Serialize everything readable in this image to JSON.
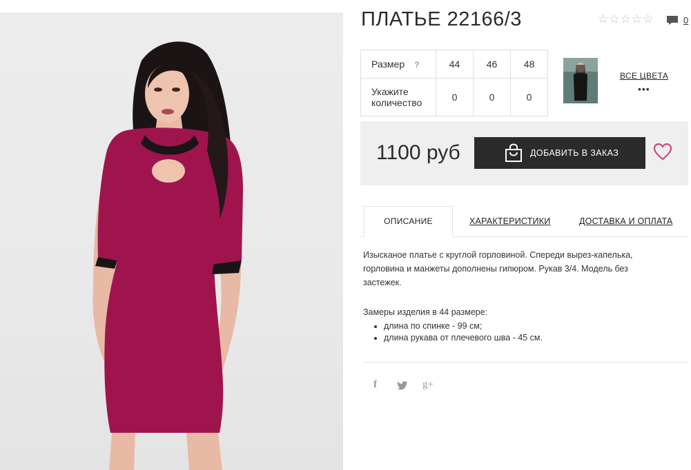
{
  "product": {
    "title": "ПЛАТЬЕ 22166/3",
    "rating_stars": 5,
    "rating_filled": 0,
    "comments_count": "0",
    "image": {
      "description_icon": "product-photo",
      "dress_color": "#a0144e"
    }
  },
  "sizes": {
    "size_label": "Размер",
    "help_mark": "?",
    "values": [
      "44",
      "46",
      "48"
    ],
    "quantity_label": "Укажите количество",
    "quantities": [
      "0",
      "0",
      "0"
    ]
  },
  "colors": {
    "all_colors_label": "ВСЕ ЦВЕТА",
    "more_dots": "•••"
  },
  "order": {
    "price": "1100 руб",
    "button_label": "ДОБАВИТЬ В ЗАКАЗ",
    "button_icon": "shopping-bag-icon",
    "wishlist_icon": "heart-icon",
    "accent_color": "#c94a77"
  },
  "tabs": [
    {
      "label": "ОПИСАНИЕ",
      "active": true
    },
    {
      "label": "ХАРАКТЕРИСТИКИ",
      "active": false
    },
    {
      "label": "ДОСТАВКА И ОПЛАТА",
      "active": false
    }
  ],
  "description": {
    "text": "Изысканое платье с круглой горловиной. Спереди вырез-капелька, горловина и манжеты дополнены гипюром. Рукав 3/4. Модель без застежек.",
    "measurements_title": "Замеры изделия в 44 размере:",
    "measurements": [
      "длина по спинке - 99 см;",
      "длина рукава от плечевого шва - 45 см."
    ]
  },
  "social": {
    "facebook": "f",
    "twitter": "twitter-icon",
    "googleplus": "g+"
  }
}
